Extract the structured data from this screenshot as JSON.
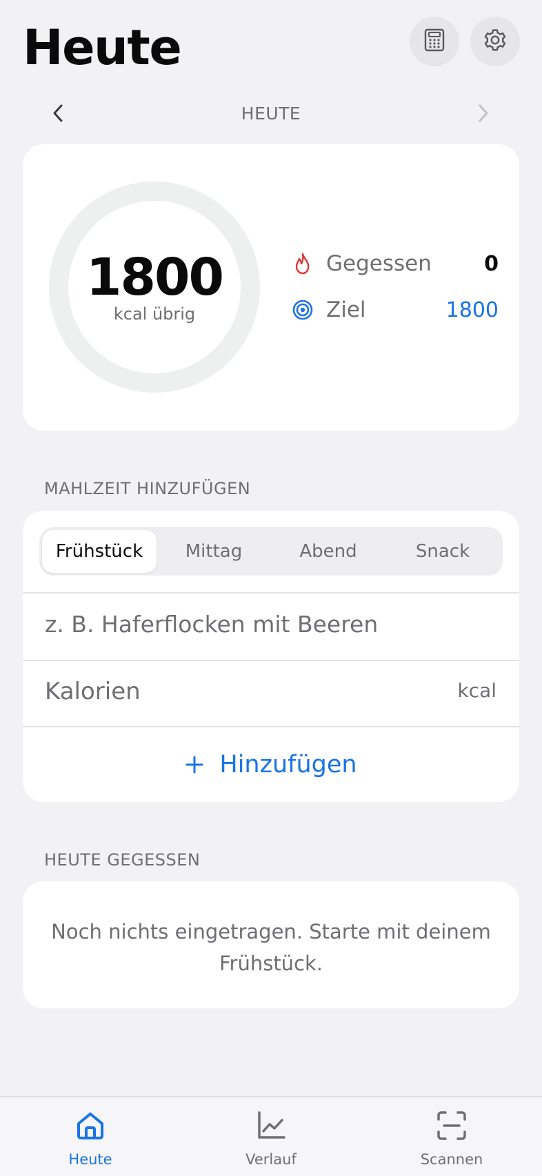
{
  "header": {
    "title": "Heute",
    "calculator_icon": "calculator-icon",
    "settings_icon": "gear-icon"
  },
  "date_nav": {
    "label": "HEUTE",
    "prev_icon": "chevron-left-icon",
    "next_icon": "chevron-right-icon"
  },
  "summary": {
    "remaining_value": "1800",
    "remaining_caption": "kcal übrig",
    "progress_fraction": 0,
    "eaten": {
      "icon": "flame-icon",
      "label": "Gegessen",
      "value": "0"
    },
    "goal": {
      "icon": "target-icon",
      "label": "Ziel",
      "value": "1800"
    }
  },
  "add_meal": {
    "section_title": "MAHLZEIT HINZUFÜGEN",
    "tabs": [
      {
        "label": "Frühstück",
        "active": true
      },
      {
        "label": "Mittag",
        "active": false
      },
      {
        "label": "Abend",
        "active": false
      },
      {
        "label": "Snack",
        "active": false
      }
    ],
    "food_placeholder": "z. B. Haferflocken mit Beeren",
    "calories_placeholder": "Kalorien",
    "calories_unit": "kcal",
    "add_button_label": "Hinzufügen"
  },
  "today_eaten": {
    "section_title": "HEUTE GEGESSEN",
    "empty_text": "Noch nichts eingetragen. Starte mit deinem Frühstück."
  },
  "tabbar": {
    "items": [
      {
        "label": "Heute",
        "icon": "home-icon",
        "active": true
      },
      {
        "label": "Verlauf",
        "icon": "chart-icon",
        "active": false
      },
      {
        "label": "Scannen",
        "icon": "scan-icon",
        "active": false
      }
    ]
  },
  "colors": {
    "accent": "#1a73e8",
    "flame": "#e0342f",
    "background": "#f2f2f4",
    "ring_track": "#eeefef"
  }
}
